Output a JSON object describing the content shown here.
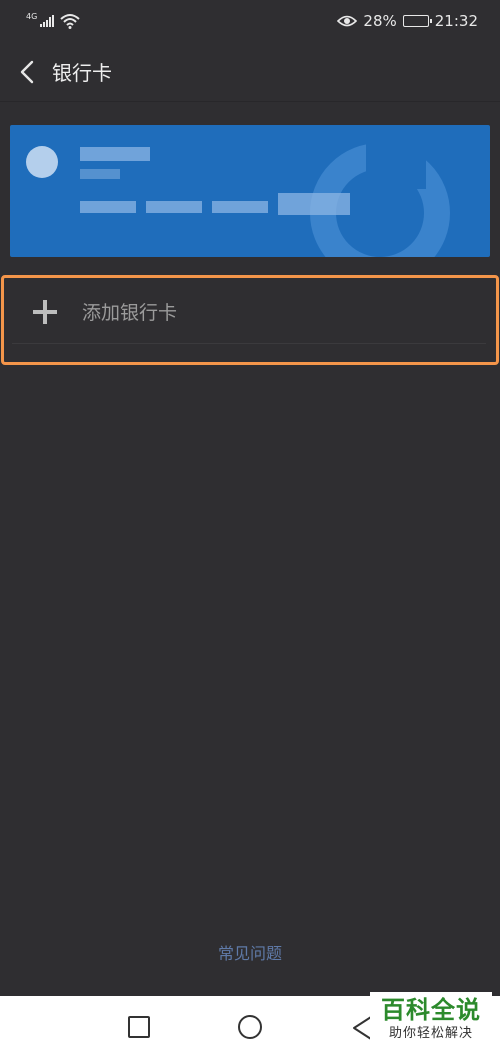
{
  "status_bar": {
    "network_label": "4G",
    "battery_percent": "28%",
    "battery_level": 0.28,
    "time": "21:32",
    "icons": [
      "signal-icon",
      "wifi-icon",
      "eye-icon",
      "battery-icon"
    ]
  },
  "header": {
    "back_icon": "chevron-left-icon",
    "title": "银行卡"
  },
  "bank_card": {
    "color": "#1f6dbb"
  },
  "add_card": {
    "label": "添加银行卡",
    "icon": "plus-icon",
    "highlight_color": "#f4954a"
  },
  "faq": {
    "label": "常见问题"
  },
  "nav_bar": {
    "icons": [
      "recent-apps-icon",
      "home-icon",
      "back-icon"
    ]
  },
  "watermark": {
    "title": "百科全说",
    "subtitle": "助你轻松解决"
  }
}
